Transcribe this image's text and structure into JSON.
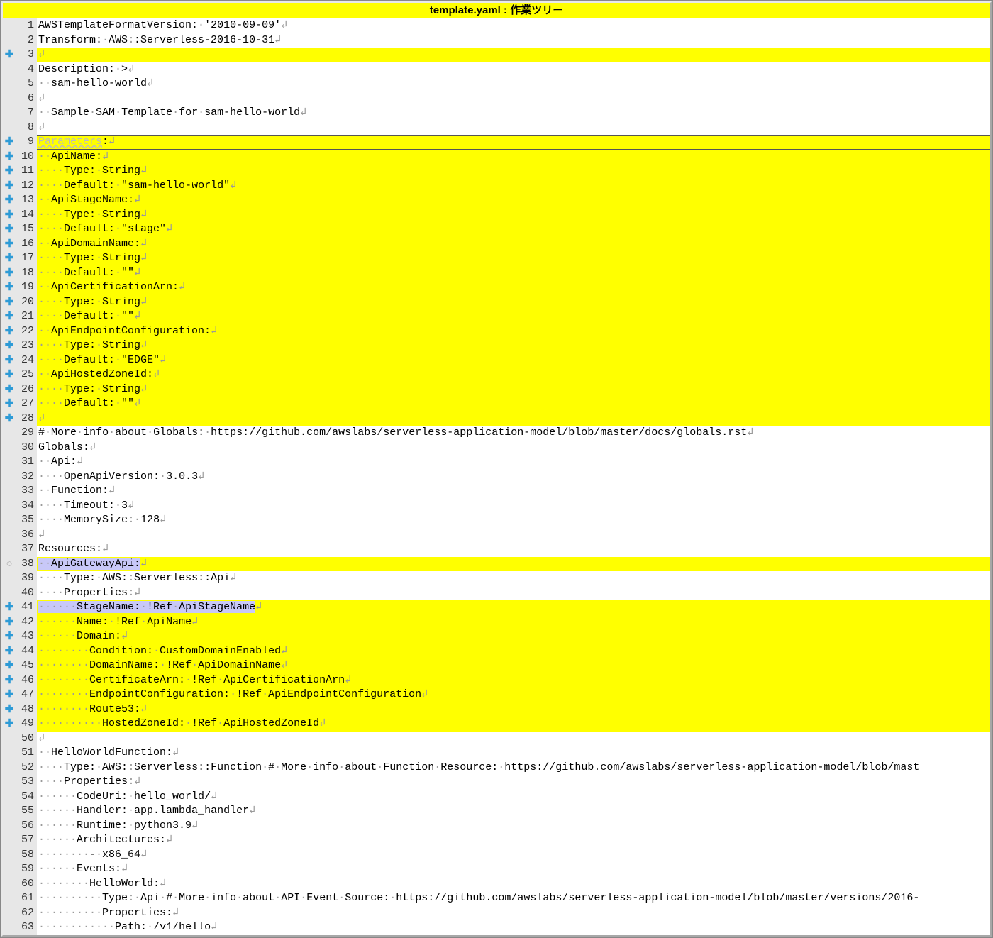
{
  "title": {
    "filename": "template.yaml",
    "sep": " : ",
    "label": "作業ツリー"
  },
  "ws_dot": "·",
  "eol": "↲",
  "lines": [
    {
      "n": 1,
      "mark": "",
      "hl": false,
      "t": "AWSTemplateFormatVersion:·'2010-09-09'",
      "eol": true
    },
    {
      "n": 2,
      "mark": "",
      "hl": false,
      "t": "Transform:·AWS::Serverless-2016-10-31",
      "eol": true
    },
    {
      "n": 3,
      "mark": "+",
      "hl": true,
      "t": "",
      "eol": true
    },
    {
      "n": 4,
      "mark": "",
      "hl": false,
      "t": "Description:·>",
      "eol": true
    },
    {
      "n": 5,
      "mark": "",
      "hl": false,
      "t": "··sam-hello-world",
      "eol": true
    },
    {
      "n": 6,
      "mark": "",
      "hl": false,
      "t": "",
      "eol": true
    },
    {
      "n": 7,
      "mark": "",
      "hl": false,
      "t": "··Sample·SAM·Template·for·sam-hello-world",
      "eol": true
    },
    {
      "n": 8,
      "mark": "",
      "hl": false,
      "t": "",
      "eol": true
    },
    {
      "n": 9,
      "mark": "+",
      "hl": true,
      "line9": true,
      "t": "",
      "pre": "",
      "grayed": "Parameters",
      "post": ":",
      "eol": true
    },
    {
      "n": 10,
      "mark": "+",
      "hl": true,
      "t": "··ApiName:",
      "eol": true
    },
    {
      "n": 11,
      "mark": "+",
      "hl": true,
      "t": "····Type:·String",
      "eol": true
    },
    {
      "n": 12,
      "mark": "+",
      "hl": true,
      "t": "····Default:·\"sam-hello-world\"",
      "eol": true
    },
    {
      "n": 13,
      "mark": "+",
      "hl": true,
      "t": "··ApiStageName:",
      "eol": true
    },
    {
      "n": 14,
      "mark": "+",
      "hl": true,
      "t": "····Type:·String",
      "eol": true
    },
    {
      "n": 15,
      "mark": "+",
      "hl": true,
      "t": "····Default:·\"stage\"",
      "eol": true
    },
    {
      "n": 16,
      "mark": "+",
      "hl": true,
      "t": "··ApiDomainName:",
      "eol": true
    },
    {
      "n": 17,
      "mark": "+",
      "hl": true,
      "t": "····Type:·String",
      "eol": true
    },
    {
      "n": 18,
      "mark": "+",
      "hl": true,
      "t": "····Default:·\"\"",
      "eol": true
    },
    {
      "n": 19,
      "mark": "+",
      "hl": true,
      "t": "··ApiCertificationArn:",
      "eol": true
    },
    {
      "n": 20,
      "mark": "+",
      "hl": true,
      "t": "····Type:·String",
      "eol": true
    },
    {
      "n": 21,
      "mark": "+",
      "hl": true,
      "t": "····Default:·\"\"",
      "eol": true
    },
    {
      "n": 22,
      "mark": "+",
      "hl": true,
      "t": "··ApiEndpointConfiguration:",
      "eol": true
    },
    {
      "n": 23,
      "mark": "+",
      "hl": true,
      "t": "····Type:·String",
      "eol": true
    },
    {
      "n": 24,
      "mark": "+",
      "hl": true,
      "t": "····Default:·\"EDGE\"",
      "eol": true
    },
    {
      "n": 25,
      "mark": "+",
      "hl": true,
      "t": "··ApiHostedZoneId:",
      "eol": true
    },
    {
      "n": 26,
      "mark": "+",
      "hl": true,
      "t": "····Type:·String",
      "eol": true
    },
    {
      "n": 27,
      "mark": "+",
      "hl": true,
      "t": "····Default:·\"\"",
      "eol": true
    },
    {
      "n": 28,
      "mark": "+",
      "hl": true,
      "t": "",
      "eol": true
    },
    {
      "n": 29,
      "mark": "",
      "hl": false,
      "t": "#·More·info·about·Globals:·https://github.com/awslabs/serverless-application-model/blob/master/docs/globals.rst",
      "eol": true
    },
    {
      "n": 30,
      "mark": "",
      "hl": false,
      "t": "Globals:",
      "eol": true
    },
    {
      "n": 31,
      "mark": "",
      "hl": false,
      "t": "··Api:",
      "eol": true
    },
    {
      "n": 32,
      "mark": "",
      "hl": false,
      "t": "····OpenApiVersion:·3.0.3",
      "eol": true
    },
    {
      "n": 33,
      "mark": "",
      "hl": false,
      "t": "··Function:",
      "eol": true
    },
    {
      "n": 34,
      "mark": "",
      "hl": false,
      "t": "····Timeout:·3",
      "eol": true
    },
    {
      "n": 35,
      "mark": "",
      "hl": false,
      "t": "····MemorySize:·128",
      "eol": true
    },
    {
      "n": 36,
      "mark": "",
      "hl": false,
      "t": "",
      "eol": true
    },
    {
      "n": 37,
      "mark": "",
      "hl": false,
      "t": "Resources:",
      "eol": true
    },
    {
      "n": 38,
      "mark": "o",
      "hl": true,
      "sel": "··ApiGatewayApi:",
      "eol": true
    },
    {
      "n": 39,
      "mark": "",
      "hl": false,
      "t": "····Type:·AWS::Serverless::Api",
      "eol": true
    },
    {
      "n": 40,
      "mark": "",
      "hl": false,
      "t": "····Properties:",
      "eol": true
    },
    {
      "n": 41,
      "mark": "+",
      "hl": true,
      "sel": "······StageName:·!Ref·ApiStageName",
      "eol": true
    },
    {
      "n": 42,
      "mark": "+",
      "hl": true,
      "t": "······Name:·!Ref·ApiName",
      "eol": true
    },
    {
      "n": 43,
      "mark": "+",
      "hl": true,
      "t": "······Domain:",
      "eol": true
    },
    {
      "n": 44,
      "mark": "+",
      "hl": true,
      "t": "········Condition:·CustomDomainEnabled",
      "eol": true
    },
    {
      "n": 45,
      "mark": "+",
      "hl": true,
      "t": "········DomainName:·!Ref·ApiDomainName",
      "eol": true
    },
    {
      "n": 46,
      "mark": "+",
      "hl": true,
      "t": "········CertificateArn:·!Ref·ApiCertificationArn",
      "eol": true
    },
    {
      "n": 47,
      "mark": "+",
      "hl": true,
      "t": "········EndpointConfiguration:·!Ref·ApiEndpointConfiguration",
      "eol": true
    },
    {
      "n": 48,
      "mark": "+",
      "hl": true,
      "t": "········Route53:",
      "eol": true
    },
    {
      "n": 49,
      "mark": "+",
      "hl": true,
      "t": "··········HostedZoneId:·!Ref·ApiHostedZoneId",
      "eol": true
    },
    {
      "n": 50,
      "mark": "",
      "hl": false,
      "t": "",
      "eol": true
    },
    {
      "n": 51,
      "mark": "",
      "hl": false,
      "t": "··HelloWorldFunction:",
      "eol": true
    },
    {
      "n": 52,
      "mark": "",
      "hl": false,
      "t": "····Type:·AWS::Serverless::Function·#·More·info·about·Function·Resource:·https://github.com/awslabs/serverless-application-model/blob/mast",
      "eol": false
    },
    {
      "n": 53,
      "mark": "",
      "hl": false,
      "t": "····Properties:",
      "eol": true
    },
    {
      "n": 54,
      "mark": "",
      "hl": false,
      "t": "······CodeUri:·hello_world/",
      "eol": true
    },
    {
      "n": 55,
      "mark": "",
      "hl": false,
      "t": "······Handler:·app.lambda_handler",
      "eol": true
    },
    {
      "n": 56,
      "mark": "",
      "hl": false,
      "t": "······Runtime:·python3.9",
      "eol": true
    },
    {
      "n": 57,
      "mark": "",
      "hl": false,
      "t": "······Architectures:",
      "eol": true
    },
    {
      "n": 58,
      "mark": "",
      "hl": false,
      "t": "········-·x86_64",
      "eol": true
    },
    {
      "n": 59,
      "mark": "",
      "hl": false,
      "t": "······Events:",
      "eol": true
    },
    {
      "n": 60,
      "mark": "",
      "hl": false,
      "t": "········HelloWorld:",
      "eol": true
    },
    {
      "n": 61,
      "mark": "",
      "hl": false,
      "t": "··········Type:·Api·#·More·info·about·API·Event·Source:·https://github.com/awslabs/serverless-application-model/blob/master/versions/2016-",
      "eol": false
    },
    {
      "n": 62,
      "mark": "",
      "hl": false,
      "t": "··········Properties:",
      "eol": true
    },
    {
      "n": 63,
      "mark": "",
      "hl": false,
      "t": "············Path:·/v1/hello",
      "eol": true
    }
  ]
}
